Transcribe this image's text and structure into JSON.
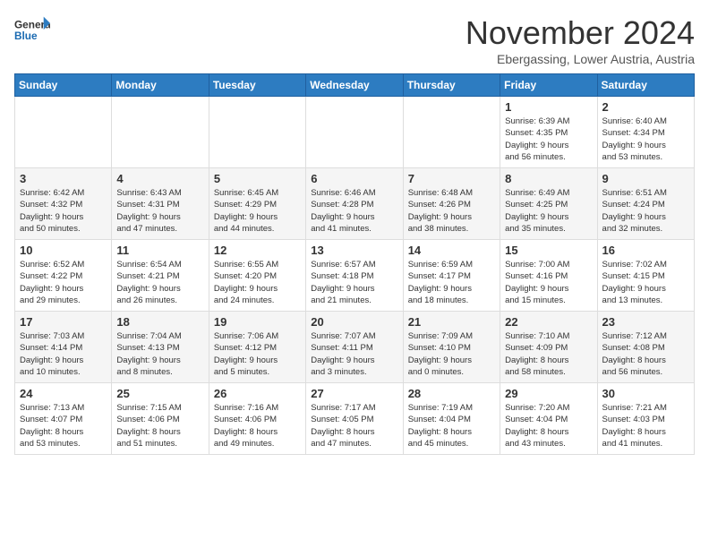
{
  "header": {
    "logo_general": "General",
    "logo_blue": "Blue",
    "month": "November 2024",
    "location": "Ebergassing, Lower Austria, Austria"
  },
  "weekdays": [
    "Sunday",
    "Monday",
    "Tuesday",
    "Wednesday",
    "Thursday",
    "Friday",
    "Saturday"
  ],
  "weeks": [
    [
      {
        "day": "",
        "info": ""
      },
      {
        "day": "",
        "info": ""
      },
      {
        "day": "",
        "info": ""
      },
      {
        "day": "",
        "info": ""
      },
      {
        "day": "",
        "info": ""
      },
      {
        "day": "1",
        "info": "Sunrise: 6:39 AM\nSunset: 4:35 PM\nDaylight: 9 hours\nand 56 minutes."
      },
      {
        "day": "2",
        "info": "Sunrise: 6:40 AM\nSunset: 4:34 PM\nDaylight: 9 hours\nand 53 minutes."
      }
    ],
    [
      {
        "day": "3",
        "info": "Sunrise: 6:42 AM\nSunset: 4:32 PM\nDaylight: 9 hours\nand 50 minutes."
      },
      {
        "day": "4",
        "info": "Sunrise: 6:43 AM\nSunset: 4:31 PM\nDaylight: 9 hours\nand 47 minutes."
      },
      {
        "day": "5",
        "info": "Sunrise: 6:45 AM\nSunset: 4:29 PM\nDaylight: 9 hours\nand 44 minutes."
      },
      {
        "day": "6",
        "info": "Sunrise: 6:46 AM\nSunset: 4:28 PM\nDaylight: 9 hours\nand 41 minutes."
      },
      {
        "day": "7",
        "info": "Sunrise: 6:48 AM\nSunset: 4:26 PM\nDaylight: 9 hours\nand 38 minutes."
      },
      {
        "day": "8",
        "info": "Sunrise: 6:49 AM\nSunset: 4:25 PM\nDaylight: 9 hours\nand 35 minutes."
      },
      {
        "day": "9",
        "info": "Sunrise: 6:51 AM\nSunset: 4:24 PM\nDaylight: 9 hours\nand 32 minutes."
      }
    ],
    [
      {
        "day": "10",
        "info": "Sunrise: 6:52 AM\nSunset: 4:22 PM\nDaylight: 9 hours\nand 29 minutes."
      },
      {
        "day": "11",
        "info": "Sunrise: 6:54 AM\nSunset: 4:21 PM\nDaylight: 9 hours\nand 26 minutes."
      },
      {
        "day": "12",
        "info": "Sunrise: 6:55 AM\nSunset: 4:20 PM\nDaylight: 9 hours\nand 24 minutes."
      },
      {
        "day": "13",
        "info": "Sunrise: 6:57 AM\nSunset: 4:18 PM\nDaylight: 9 hours\nand 21 minutes."
      },
      {
        "day": "14",
        "info": "Sunrise: 6:59 AM\nSunset: 4:17 PM\nDaylight: 9 hours\nand 18 minutes."
      },
      {
        "day": "15",
        "info": "Sunrise: 7:00 AM\nSunset: 4:16 PM\nDaylight: 9 hours\nand 15 minutes."
      },
      {
        "day": "16",
        "info": "Sunrise: 7:02 AM\nSunset: 4:15 PM\nDaylight: 9 hours\nand 13 minutes."
      }
    ],
    [
      {
        "day": "17",
        "info": "Sunrise: 7:03 AM\nSunset: 4:14 PM\nDaylight: 9 hours\nand 10 minutes."
      },
      {
        "day": "18",
        "info": "Sunrise: 7:04 AM\nSunset: 4:13 PM\nDaylight: 9 hours\nand 8 minutes."
      },
      {
        "day": "19",
        "info": "Sunrise: 7:06 AM\nSunset: 4:12 PM\nDaylight: 9 hours\nand 5 minutes."
      },
      {
        "day": "20",
        "info": "Sunrise: 7:07 AM\nSunset: 4:11 PM\nDaylight: 9 hours\nand 3 minutes."
      },
      {
        "day": "21",
        "info": "Sunrise: 7:09 AM\nSunset: 4:10 PM\nDaylight: 9 hours\nand 0 minutes."
      },
      {
        "day": "22",
        "info": "Sunrise: 7:10 AM\nSunset: 4:09 PM\nDaylight: 8 hours\nand 58 minutes."
      },
      {
        "day": "23",
        "info": "Sunrise: 7:12 AM\nSunset: 4:08 PM\nDaylight: 8 hours\nand 56 minutes."
      }
    ],
    [
      {
        "day": "24",
        "info": "Sunrise: 7:13 AM\nSunset: 4:07 PM\nDaylight: 8 hours\nand 53 minutes."
      },
      {
        "day": "25",
        "info": "Sunrise: 7:15 AM\nSunset: 4:06 PM\nDaylight: 8 hours\nand 51 minutes."
      },
      {
        "day": "26",
        "info": "Sunrise: 7:16 AM\nSunset: 4:06 PM\nDaylight: 8 hours\nand 49 minutes."
      },
      {
        "day": "27",
        "info": "Sunrise: 7:17 AM\nSunset: 4:05 PM\nDaylight: 8 hours\nand 47 minutes."
      },
      {
        "day": "28",
        "info": "Sunrise: 7:19 AM\nSunset: 4:04 PM\nDaylight: 8 hours\nand 45 minutes."
      },
      {
        "day": "29",
        "info": "Sunrise: 7:20 AM\nSunset: 4:04 PM\nDaylight: 8 hours\nand 43 minutes."
      },
      {
        "day": "30",
        "info": "Sunrise: 7:21 AM\nSunset: 4:03 PM\nDaylight: 8 hours\nand 41 minutes."
      }
    ]
  ]
}
